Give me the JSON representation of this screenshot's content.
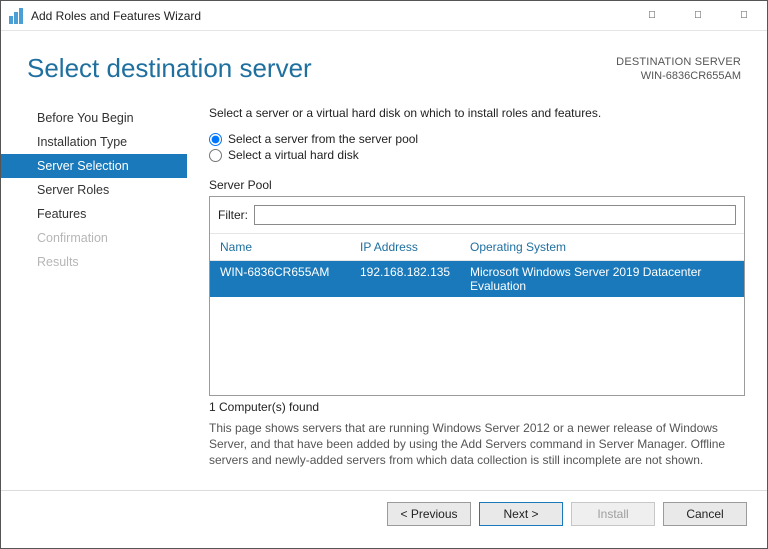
{
  "window": {
    "title": "Add Roles and Features Wizard"
  },
  "header": {
    "title": "Select destination server",
    "dest_label": "DESTINATION SERVER",
    "dest_value": "WIN-6836CR655AM"
  },
  "nav": {
    "items": [
      {
        "label": "Before You Begin",
        "state": "normal"
      },
      {
        "label": "Installation Type",
        "state": "normal"
      },
      {
        "label": "Server Selection",
        "state": "active"
      },
      {
        "label": "Server Roles",
        "state": "normal"
      },
      {
        "label": "Features",
        "state": "normal"
      },
      {
        "label": "Confirmation",
        "state": "disabled"
      },
      {
        "label": "Results",
        "state": "disabled"
      }
    ]
  },
  "content": {
    "instruction": "Select a server or a virtual hard disk on which to install roles and features.",
    "radio_pool": "Select a server from the server pool",
    "radio_vhd": "Select a virtual hard disk",
    "pool_label": "Server Pool",
    "filter_label": "Filter:",
    "filter_value": "",
    "columns": {
      "name": "Name",
      "ip": "IP Address",
      "os": "Operating System"
    },
    "rows": [
      {
        "name": "WIN-6836CR655AM",
        "ip": "192.168.182.135",
        "os": "Microsoft Windows Server 2019 Datacenter Evaluation"
      }
    ],
    "count": "1 Computer(s) found",
    "note": "This page shows servers that are running Windows Server 2012 or a newer release of Windows Server, and that have been added by using the Add Servers command in Server Manager. Offline servers and newly-added servers from which data collection is still incomplete are not shown."
  },
  "footer": {
    "previous": "< Previous",
    "next": "Next >",
    "install": "Install",
    "cancel": "Cancel"
  }
}
